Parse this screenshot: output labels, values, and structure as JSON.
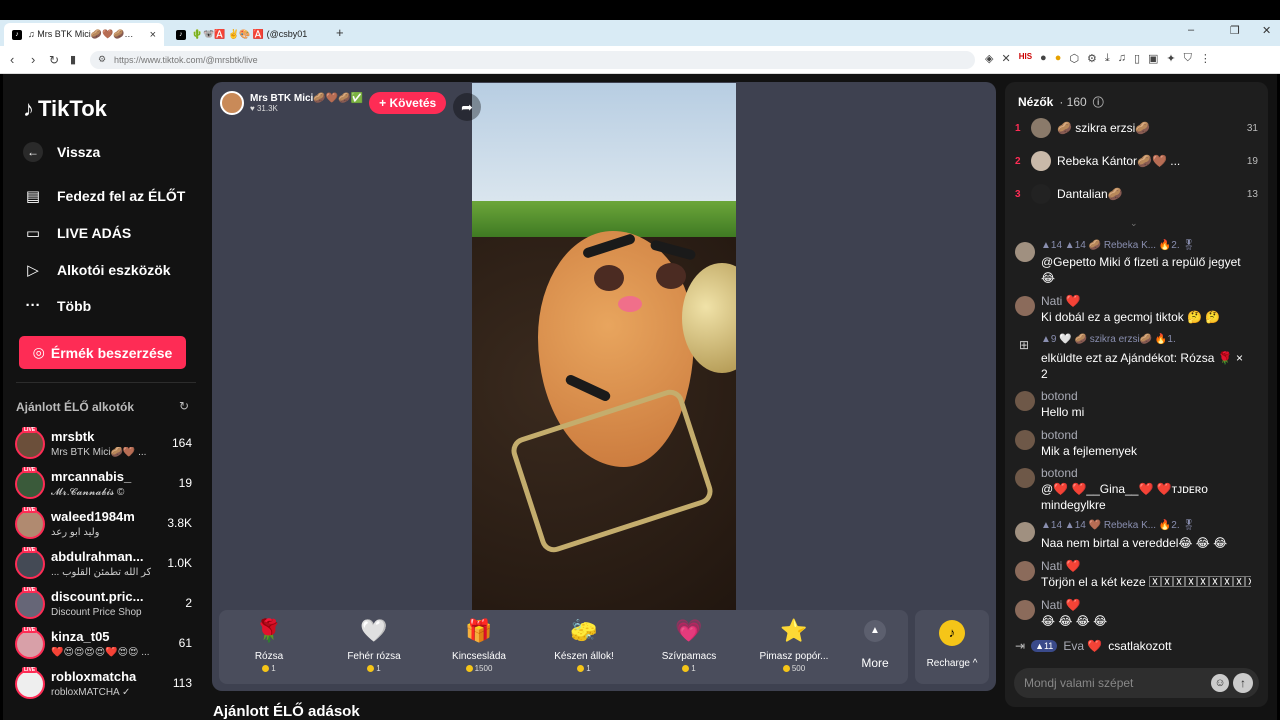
{
  "browser": {
    "tabs": [
      {
        "title": "♫ Mrs BTK Mici🥔🤎🥔✅ (@m"
      },
      {
        "title": "🌵🐨🅰️ ✌️🎨 🅰️ (@csby01"
      }
    ],
    "url": "https://www.tiktok.com/@mrsbtk/live"
  },
  "sidebar": {
    "logo": "TikTok",
    "back": "Vissza",
    "nav": [
      {
        "label": "Fedezd fel az ÉLŐT",
        "icon": "calendar-live-icon"
      },
      {
        "label": "LIVE ADÁS",
        "icon": "camera-icon"
      },
      {
        "label": "Alkotói eszközök",
        "icon": "play-icon"
      },
      {
        "label": "Több",
        "icon": "more-icon"
      }
    ],
    "coin_button": "Érmék beszerzése",
    "recommended_title": "Ajánlott ÉLŐ alkotók",
    "creators": [
      {
        "name": "mrsbtk",
        "sub": "Mrs BTK Mici🥔🤎 ...",
        "count": "164"
      },
      {
        "name": "mrcannabis_",
        "sub": "𝓜𝓻.𝓒𝓪𝓷𝓷𝓪𝓫𝓲𝓼 ©",
        "count": "19"
      },
      {
        "name": "waleed1984m",
        "sub": "وليد ابو رعد",
        "count": "3.8K"
      },
      {
        "name": "abdulrahman...",
        "sub": "... ألا بذكر الله تطمئن القلوب",
        "count": "1.0K"
      },
      {
        "name": "discount.pric...",
        "sub": "Discount Price Shop",
        "count": "2"
      },
      {
        "name": "kinza_t05",
        "sub": "❤️😍😍😍😍❤️😍😍 ...",
        "count": "61"
      },
      {
        "name": "robloxmatcha",
        "sub": "robloxMATCHA ✓",
        "count": "113"
      }
    ]
  },
  "stream": {
    "host_name": "Mrs BTK Mici🥔🤎🥔✅",
    "host_likes": "♥ 31.3K",
    "follow_label": "+ Követés",
    "gifts": [
      {
        "name": "Rózsa",
        "price": "1",
        "emoji": "🌹"
      },
      {
        "name": "Fehér rózsa",
        "price": "1",
        "emoji": "🤍"
      },
      {
        "name": "Kincsesláda",
        "price": "1500",
        "emoji": "🎁"
      },
      {
        "name": "Készen állok!",
        "price": "1",
        "emoji": "🧽"
      },
      {
        "name": "Szívpamacs",
        "price": "1",
        "emoji": "💗"
      },
      {
        "name": "Pimasz popór...",
        "price": "500",
        "emoji": "⭐"
      }
    ],
    "more_label": "More",
    "recharge_label": "Recharge ^"
  },
  "below_title": "Ajánlott ÉLŐ adások",
  "chat": {
    "viewers_label": "Nézők",
    "viewers_count": "· 160",
    "top_viewers": [
      {
        "rank": "1",
        "name": "🥔 szikra erzsi🥔",
        "score": "31"
      },
      {
        "rank": "2",
        "name": "Rebeka Kántor🥔🤎 ...",
        "score": "19"
      },
      {
        "rank": "3",
        "name": "Dantalian🥔",
        "score": "13"
      }
    ],
    "messages": [
      {
        "badges": "▲14 ▲14 🥔 Rebeka K... 🔥2. 🎖",
        "text": "@Gepetto Miki ő fizeti a repülő jegyet😂"
      },
      {
        "name": "Nati ❤️",
        "text": "Ki dobál ez a gecmoj tiktok 🤔 🤔"
      },
      {
        "badges": "▲9 🤍 🥔 szikra erzsi🥔 🔥1.",
        "text": "elküldte ezt az Ajándékot: Rózsa 🌹 × 2"
      },
      {
        "name": "botond",
        "text": "Hello mi"
      },
      {
        "name": "botond",
        "text": "Mik a fejlemenyek"
      },
      {
        "name": "botond",
        "text": "@❤️ ❤️__Gina__❤️ ❤️ᴛᴊᴅᴇʀᴏ mindegylkre"
      },
      {
        "badges": "▲14 ▲14 🤎 Rebeka K... 🔥2. 🎖",
        "text": "Naa nem birtal a vereddel😂 😂 😂"
      },
      {
        "name": "Nati ❤️",
        "text": "Törjön el a két keze 🅇🅇🅇🅇🅇🅇🅇🅇🅇🅇🅇🅇🅇🅇"
      },
      {
        "name": "Nati ❤️",
        "text": "😂 😂 😂 😂"
      }
    ],
    "join_badge": "▲11",
    "join_name": "Eva ❤️",
    "join_text": "csatlakozott",
    "input_placeholder": "Mondj valami szépet"
  },
  "colors": {
    "accent": "#fe2c55",
    "background": "#121212",
    "panel": "#1e1e1e",
    "stage": "#3e4150"
  }
}
